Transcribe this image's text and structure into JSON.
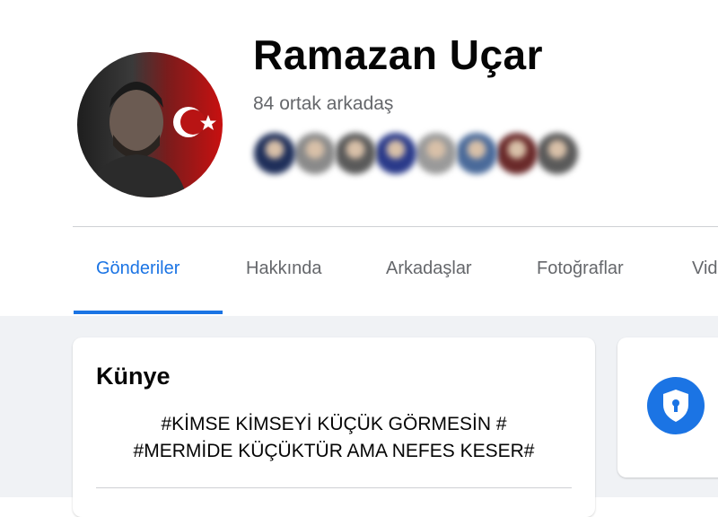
{
  "profile": {
    "name": "Ramazan Uçar",
    "mutual_friends": "84 ortak arkadaş"
  },
  "friend_avatar_colors": [
    "#1f2f5a",
    "#8a8a8a",
    "#5a5a5a",
    "#2a3a8a",
    "#9a9a9a",
    "#4a6a9a",
    "#6a2a2a",
    "#5a5a5a"
  ],
  "tabs": [
    {
      "label": "Gönderiler",
      "active": true
    },
    {
      "label": "Hakkında",
      "active": false
    },
    {
      "label": "Arkadaşlar",
      "active": false
    },
    {
      "label": "Fotoğraflar",
      "active": false
    },
    {
      "label": "Vid",
      "active": false
    }
  ],
  "intro": {
    "title": "Künye",
    "bio_line1": "#KİMSE KİMSEYİ KÜÇÜK GÖRMESİN #",
    "bio_line2": "#MERMİDE KÜÇÜKTÜR AMA NEFES KESER#"
  },
  "colors": {
    "accent": "#1b74e4",
    "background": "#f0f2f5",
    "secondary_text": "#65676b"
  },
  "icons": {
    "side_card_icon": "shield-lock-icon"
  }
}
